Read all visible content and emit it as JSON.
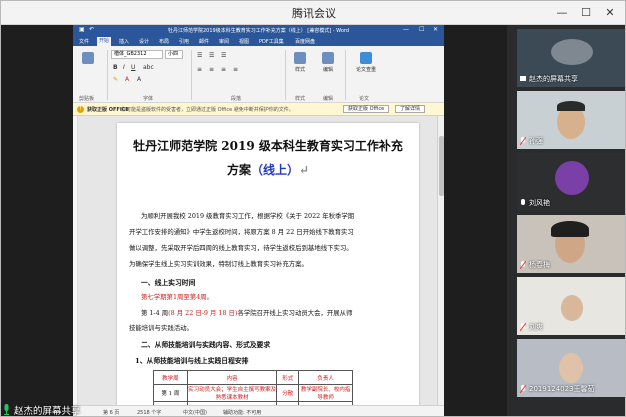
{
  "window": {
    "title": "腾讯会议",
    "controls": {
      "minimize": "—",
      "maximize": "☐",
      "close": "✕"
    }
  },
  "word": {
    "title": "牡丹江师范学院2019级本科生教育实习工作补充方案（线上） [兼容模式] - Word",
    "tabs": [
      "文件",
      "开始",
      "插入",
      "设计",
      "布局",
      "引用",
      "邮件",
      "审阅",
      "视图",
      "PDF工具集",
      "百度网盘"
    ],
    "active_tab": "开始",
    "font_name": "楷体_GB2312",
    "font_size": "小四",
    "ribbon_groups": [
      "剪贴板",
      "字体",
      "段落",
      "样式",
      "编辑"
    ],
    "ribbon_buttons": [
      "样式",
      "编辑",
      "论文查重",
      "论文"
    ],
    "notification": {
      "label": "获取正版 OFFICE",
      "text": "你可能是盗版软件的受害者，立即通过正版 Office 避免中断并保护你的文件。",
      "buttons": [
        "获取正版 Office",
        "了解详情"
      ]
    },
    "status": {
      "page": "第 6 页",
      "words": "2518 个字",
      "lang": "中文(中国)",
      "mode": "辅助功能: 不可用"
    }
  },
  "document": {
    "title_line1": "牡丹江师范学院 2019 级本科生教育实习工作补充",
    "title_line2_black": "方案",
    "title_line2_blue": "（线上）",
    "para1": [
      "为顺利开展我校 2019 级教育实习工作，根据学校《关于 2022 年秋季学期",
      "开学工作安排的通知》中学生返校时间，将原方案 8 月 22 日开始线下教育实习",
      "做以调整，先采取开学后四周的线上教育实习，待学生返校后到基地线下实习。",
      "为确保学生线上实习实训效果，特制订线上教育实习补充方案。"
    ],
    "heading1": "一、线上实习时间",
    "time_red": "第七学期第1周至第4周。",
    "time_line_a_black": "第 1-4 周",
    "time_line_a_red": "(8 月 22 日-9 月 18 日)",
    "time_line_a_rest": "各学院召开线上实习动员大会，开展从师",
    "time_line_b": "技能培训与实践活动。",
    "heading2": "二、从师技能培训与实践内容、形式及要求",
    "heading3": "1、从师技能培训与线上实践日程安排",
    "table": {
      "headers": [
        "教学周",
        "内容",
        "形式",
        "负责人"
      ],
      "rows": [
        [
          "第 1 周",
          "实习动员大会；学生自主撰写教案及熟悉课本教材",
          "分散",
          "教学副院长、校内指导教师"
        ],
        [
          "",
          "以小组为单位研磨教案",
          "集中",
          ""
        ]
      ]
    }
  },
  "sharer_label": "赵杰的屏幕共享",
  "participants": [
    {
      "name": "赵杰的屏幕共享",
      "bg": "#3b4a55"
    },
    {
      "name": "孙强",
      "bg": "#c9d0d4"
    },
    {
      "name": "刘风艳",
      "bg": "#2d2e30"
    },
    {
      "name": "杨春梅",
      "bg": "#c8c2bb"
    },
    {
      "name": "刘爽",
      "bg": "#e8e6e1"
    },
    {
      "name": "2019124023王馨茹",
      "bg": "#b8bcc4"
    }
  ],
  "colors": {
    "word_blue": "#2b579a",
    "doc_red": "#d21b1b",
    "doc_blue": "#2337c6",
    "panel_bg": "#2a2b2d"
  }
}
